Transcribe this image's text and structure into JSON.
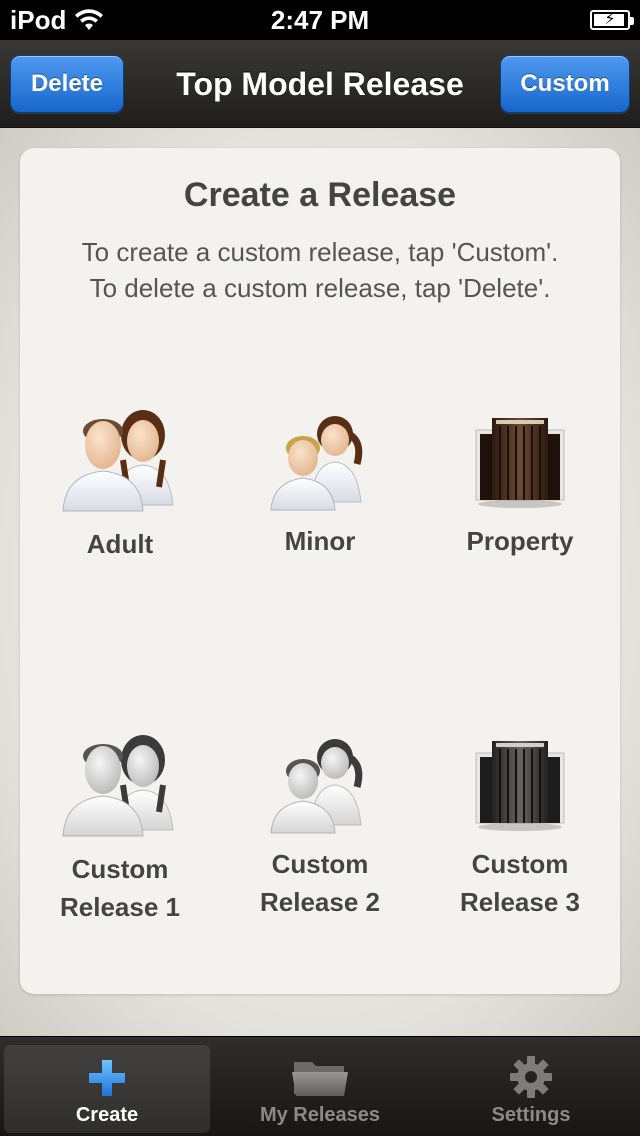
{
  "status": {
    "carrier": "iPod",
    "time": "2:47 PM"
  },
  "nav": {
    "title": "Top Model Release",
    "delete_label": "Delete",
    "custom_label": "Custom"
  },
  "card": {
    "title": "Create a Release",
    "line1": "To create a custom release, tap 'Custom'.",
    "line2": "To delete a custom release, tap 'Delete'."
  },
  "tiles": [
    {
      "label": "Adult",
      "icon": "adult-people-icon"
    },
    {
      "label": "Minor",
      "icon": "minor-people-icon"
    },
    {
      "label": "Property",
      "icon": "property-building-icon"
    },
    {
      "label1": "Custom",
      "label2": "Release 1",
      "icon": "custom-adult-people-icon"
    },
    {
      "label1": "Custom",
      "label2": "Release 2",
      "icon": "custom-minor-people-icon"
    },
    {
      "label1": "Custom",
      "label2": "Release 3",
      "icon": "custom-property-building-icon"
    }
  ],
  "tabs": [
    {
      "label": "Create",
      "icon": "plus-icon",
      "selected": true
    },
    {
      "label": "My Releases",
      "icon": "folder-icon",
      "selected": false
    },
    {
      "label": "Settings",
      "icon": "gear-icon",
      "selected": false
    }
  ],
  "colors": {
    "accent_blue": "#1f74d8",
    "nav_dark": "#2a2927"
  }
}
